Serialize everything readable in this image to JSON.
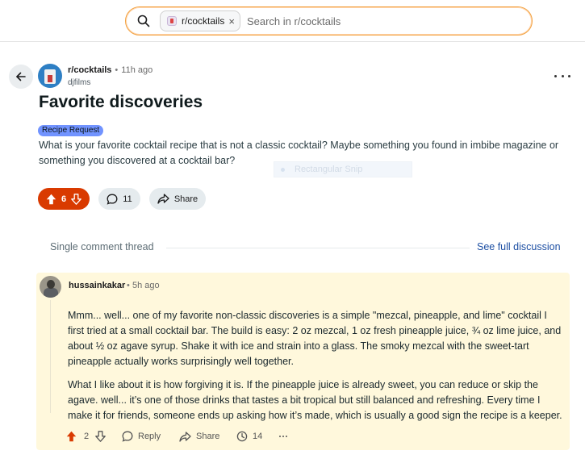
{
  "search": {
    "chip_label": "r/cocktails",
    "chip_close": "×",
    "placeholder": "Search in r/cocktails"
  },
  "post": {
    "subreddit": "r/cocktails",
    "separator": "•",
    "time_ago": "11h ago",
    "author": "djfilms",
    "title": "Favorite discoveries",
    "flair": "Recipe Request",
    "body": "What is your favorite cocktail recipe that is not a classic cocktail? Maybe something you found in imbibe magazine or something you discovered at a cocktail bar?",
    "vote_count": "6",
    "comment_count": "11",
    "share_label": "Share"
  },
  "overlay": {
    "snip_label": "Rectangular Snip"
  },
  "thread": {
    "label": "Single comment thread",
    "see_full_label": "See full discussion"
  },
  "comment": {
    "username": "hussainkakar",
    "separator": "•",
    "time_ago": "5h ago",
    "paragraph1": "Mmm... well... one of my favorite non-classic discoveries is a simple \"mezcal, pineapple, and lime\" cocktail I first tried at a small cocktail bar. The build is easy: 2 oz mezcal, 1 oz fresh pineapple juice, ¾ oz lime juice, and about ½ oz agave syrup. Shake it with ice and strain into a glass. The smoky mezcal with the sweet-tart pineapple actually works surprisingly well together.",
    "paragraph2": "What I like about it is how forgiving it is. If the pineapple juice is already sweet, you can reduce or skip the agave. well... it’s one of those drinks that tastes a bit tropical but still balanced and refreshing. Every time I make it for friends, someone ends up asking how it’s made, which is usually a good sign the recipe is a keeper.",
    "vote_count": "2",
    "reply_label": "Reply",
    "share_label": "Share",
    "award_count": "14"
  },
  "colors": {
    "accent_upvote": "#d93a00",
    "search_border": "#f2a03d",
    "flair_bg": "#7193ff",
    "comment_highlight": "#fff8dc",
    "link": "#1d4fa3"
  },
  "icons": [
    "search-icon",
    "back-arrow-icon",
    "upvote-icon",
    "downvote-icon",
    "comment-icon",
    "share-icon",
    "award-icon",
    "more-icon"
  ]
}
